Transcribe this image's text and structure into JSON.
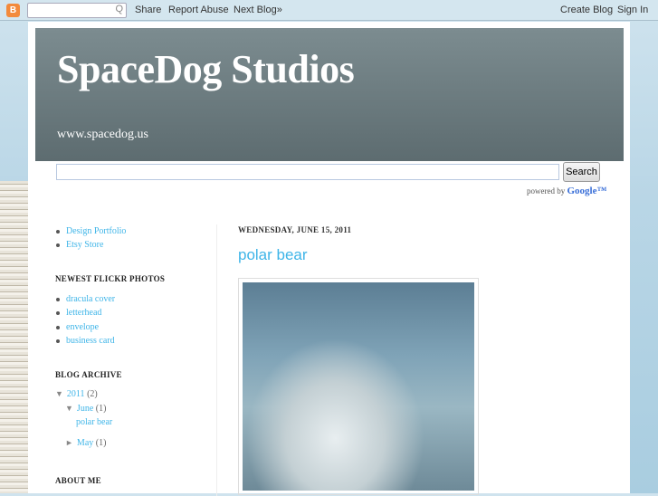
{
  "navbar": {
    "logo": "B",
    "search_placeholder": "",
    "search_icon": "Q",
    "share": "Share",
    "report_abuse": "Report Abuse",
    "next_blog": "Next Blog»",
    "create_blog": "Create Blog",
    "sign_in": "Sign In"
  },
  "header": {
    "title": "SpaceDog Studios",
    "url": "www.spacedog.us"
  },
  "search": {
    "button": "Search",
    "powered": "powered by",
    "google": "Google™"
  },
  "sidebar": {
    "links": [
      "Design Portfolio",
      "Etsy Store"
    ],
    "flickr_title": "NEWEST FLICKR PHOTOS",
    "flickr": [
      "dracula cover",
      "letterhead",
      "envelope",
      "business card"
    ],
    "archive_title": "BLOG ARCHIVE",
    "archive": {
      "year": "2011",
      "year_count": "(2)",
      "june": "June",
      "june_count": "(1)",
      "post": "polar bear",
      "may": "May",
      "may_count": "(1)"
    },
    "about_title": "ABOUT ME"
  },
  "post": {
    "date": "WEDNESDAY, JUNE 15, 2011",
    "title": "polar bear"
  }
}
